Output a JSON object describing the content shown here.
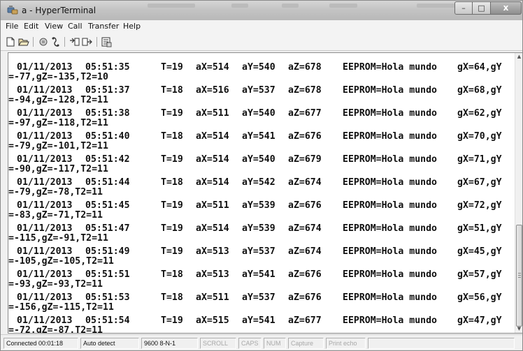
{
  "window": {
    "title": "a - HyperTerminal",
    "controls": {
      "minimize": "–",
      "maximize": "□",
      "close": "x"
    }
  },
  "menu": [
    "File",
    "Edit",
    "View",
    "Call",
    "Transfer",
    "Help"
  ],
  "toolbar": {
    "buttons": [
      "new-connection-icon",
      "open-icon",
      "disconnect-icon",
      "dial-icon",
      "send-icon",
      "receive-icon",
      "properties-icon"
    ]
  },
  "terminal": {
    "records": [
      {
        "date": "01/11/2013",
        "time": "05:51:35",
        "t": "T=19",
        "ax": "aX=514",
        "ay": "aY=540",
        "az": "aZ=678",
        "ee": "EEPROM=Hola mundo",
        "gx": "gX=64,gY",
        "cont": "=-77,gZ=-135,T2=10"
      },
      {
        "date": "01/11/2013",
        "time": "05:51:37",
        "t": "T=18",
        "ax": "aX=516",
        "ay": "aY=537",
        "az": "aZ=678",
        "ee": "EEPROM=Hola mundo",
        "gx": "gX=68,gY",
        "cont": "=-94,gZ=-128,T2=11"
      },
      {
        "date": "01/11/2013",
        "time": "05:51:38",
        "t": "T=19",
        "ax": "aX=511",
        "ay": "aY=540",
        "az": "aZ=677",
        "ee": "EEPROM=Hola mundo",
        "gx": "gX=62,gY",
        "cont": "=-97,gZ=-118,T2=11"
      },
      {
        "date": "01/11/2013",
        "time": "05:51:40",
        "t": "T=18",
        "ax": "aX=514",
        "ay": "aY=541",
        "az": "aZ=676",
        "ee": "EEPROM=Hola mundo",
        "gx": "gX=70,gY",
        "cont": "=-79,gZ=-101,T2=11"
      },
      {
        "date": "01/11/2013",
        "time": "05:51:42",
        "t": "T=19",
        "ax": "aX=514",
        "ay": "aY=540",
        "az": "aZ=679",
        "ee": "EEPROM=Hola mundo",
        "gx": "gX=71,gY",
        "cont": "=-90,gZ=-117,T2=11"
      },
      {
        "date": "01/11/2013",
        "time": "05:51:44",
        "t": "T=18",
        "ax": "aX=514",
        "ay": "aY=542",
        "az": "aZ=674",
        "ee": "EEPROM=Hola mundo",
        "gx": "gX=67,gY",
        "cont": "=-79,gZ=-78,T2=11"
      },
      {
        "date": "01/11/2013",
        "time": "05:51:45",
        "t": "T=19",
        "ax": "aX=511",
        "ay": "aY=539",
        "az": "aZ=676",
        "ee": "EEPROM=Hola mundo",
        "gx": "gX=72,gY",
        "cont": "=-83,gZ=-71,T2=11"
      },
      {
        "date": "01/11/2013",
        "time": "05:51:47",
        "t": "T=19",
        "ax": "aX=514",
        "ay": "aY=539",
        "az": "aZ=674",
        "ee": "EEPROM=Hola mundo",
        "gx": "gX=51,gY",
        "cont": "=-115,gZ=-91,T2=11"
      },
      {
        "date": "01/11/2013",
        "time": "05:51:49",
        "t": "T=19",
        "ax": "aX=513",
        "ay": "aY=537",
        "az": "aZ=674",
        "ee": "EEPROM=Hola mundo",
        "gx": "gX=45,gY",
        "cont": "=-105,gZ=-105,T2=11"
      },
      {
        "date": "01/11/2013",
        "time": "05:51:51",
        "t": "T=18",
        "ax": "aX=513",
        "ay": "aY=541",
        "az": "aZ=676",
        "ee": "EEPROM=Hola mundo",
        "gx": "gX=57,gY",
        "cont": "=-93,gZ=-93,T2=11"
      },
      {
        "date": "01/11/2013",
        "time": "05:51:53",
        "t": "T=18",
        "ax": "aX=511",
        "ay": "aY=537",
        "az": "aZ=676",
        "ee": "EEPROM=Hola mundo",
        "gx": "gX=56,gY",
        "cont": "=-156,gZ=-115,T2=11"
      },
      {
        "date": "01/11/2013",
        "time": "05:51:54",
        "t": "T=19",
        "ax": "aX=515",
        "ay": "aY=541",
        "az": "aZ=677",
        "ee": "EEPROM=Hola mundo",
        "gx": "gX=47,gY",
        "cont": "=-72,gZ=-87,T2=11"
      }
    ]
  },
  "status": {
    "connected": "Connected 00:01:18",
    "detect": "Auto detect",
    "settings": "9600 8-N-1",
    "scroll": "SCROLL",
    "caps": "CAPS",
    "num": "NUM",
    "capture": "Capture",
    "print_echo": "Print echo"
  }
}
